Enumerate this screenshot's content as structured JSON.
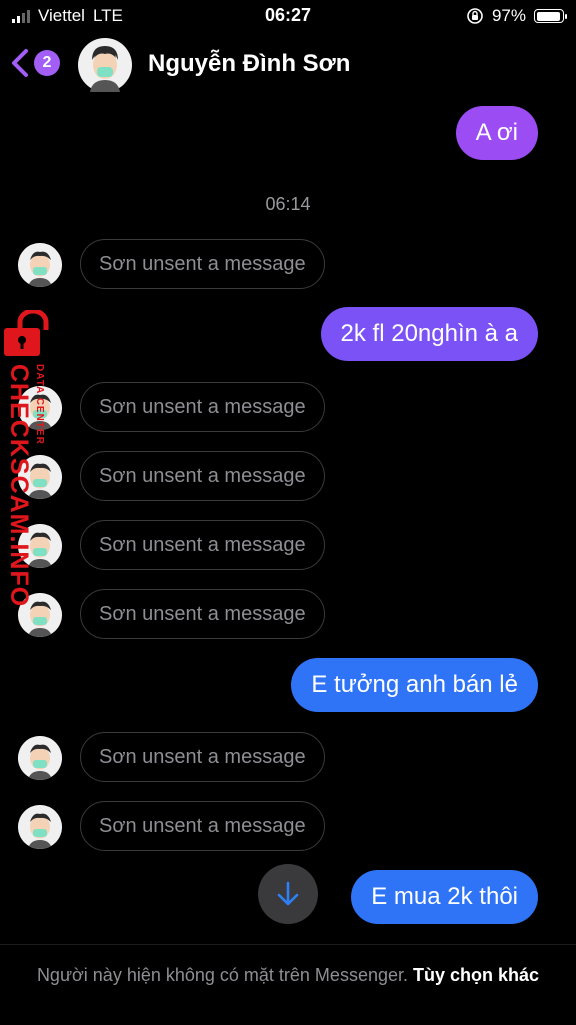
{
  "status_bar": {
    "carrier": "Viettel",
    "network": "LTE",
    "time": "06:27",
    "battery": "97%",
    "battery_level": 0.97
  },
  "header": {
    "unread_count": "2",
    "contact_name": "Nguyễn Đình Sơn"
  },
  "messages": {
    "m1": "A ơi",
    "timestamp": "06:14",
    "unsent": "Sơn unsent a message",
    "m2": "2k fl 20nghìn à a",
    "m3": "E tưởng anh bán lẻ",
    "m4": "E mua 2k thôi"
  },
  "watermark": {
    "text": "CHECKSCAM.INFO",
    "sub": "DATA CENTER"
  },
  "footer": {
    "notice": "Người này hiện không có mặt trên Messenger.",
    "action": "Tùy chọn khác"
  },
  "colors": {
    "bubble_purple": "#9b4cf3",
    "bubble_violet": "#7a52f5",
    "bubble_blue": "#2f74f6",
    "accent": "#a25ef5",
    "watermark_red": "#e0161d"
  }
}
